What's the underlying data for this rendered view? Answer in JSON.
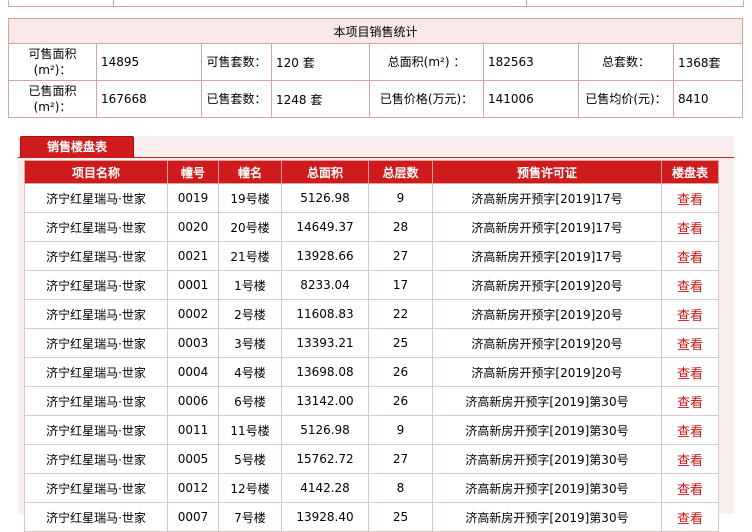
{
  "summary": {
    "title": "本项目销售统计",
    "rows": [
      [
        {
          "label": "可售面积(m²)：",
          "value": "14895"
        },
        {
          "label": "可售套数：",
          "value": "120 套"
        },
        {
          "label": "总面积(m²) ：",
          "value": "182563"
        },
        {
          "label": "总套数：",
          "value": "1368套"
        }
      ],
      [
        {
          "label": "已售面积(m²)：",
          "value": "167668"
        },
        {
          "label": "已售套数：",
          "value": "1248 套"
        },
        {
          "label": "已售价格(万元)：",
          "value": "141006"
        },
        {
          "label": "已售均价(元)：",
          "value": "8410"
        }
      ]
    ]
  },
  "sales_table": {
    "tab_label": "销售楼盘表",
    "headers": [
      "项目名称",
      "幢号",
      "幢名",
      "总面积",
      "总层数",
      "预售许可证",
      "楼盘表"
    ],
    "rows": [
      [
        "济宁红星瑞马·世家",
        "0019",
        "19号楼",
        "5126.98",
        "9",
        "济高新房开预字[2019]17号",
        "查看"
      ],
      [
        "济宁红星瑞马·世家",
        "0020",
        "20号楼",
        "14649.37",
        "28",
        "济高新房开预字[2019]17号",
        "查看"
      ],
      [
        "济宁红星瑞马·世家",
        "0021",
        "21号楼",
        "13928.66",
        "27",
        "济高新房开预字[2019]17号",
        "查看"
      ],
      [
        "济宁红星瑞马·世家",
        "0001",
        "1号楼",
        "8233.04",
        "17",
        "济高新房开预字[2019]20号",
        "查看"
      ],
      [
        "济宁红星瑞马·世家",
        "0002",
        "2号楼",
        "11608.83",
        "22",
        "济高新房开预字[2019]20号",
        "查看"
      ],
      [
        "济宁红星瑞马·世家",
        "0003",
        "3号楼",
        "13393.21",
        "25",
        "济高新房开预字[2019]20号",
        "查看"
      ],
      [
        "济宁红星瑞马·世家",
        "0004",
        "4号楼",
        "13698.08",
        "26",
        "济高新房开预字[2019]20号",
        "查看"
      ],
      [
        "济宁红星瑞马·世家",
        "0006",
        "6号楼",
        "13142.00",
        "26",
        "济高新房开预字[2019]第30号",
        "查看"
      ],
      [
        "济宁红星瑞马·世家",
        "0011",
        "11号楼",
        "5126.98",
        "9",
        "济高新房开预字[2019]第30号",
        "查看"
      ],
      [
        "济宁红星瑞马·世家",
        "0005",
        "5号楼",
        "15762.72",
        "27",
        "济高新房开预字[2019]第30号",
        "查看"
      ],
      [
        "济宁红星瑞马·世家",
        "0012",
        "12号楼",
        "4142.28",
        "8",
        "济高新房开预字[2019]第30号",
        "查看"
      ],
      [
        "济宁红星瑞马·世家",
        "0007",
        "7号楼",
        "13928.40",
        "25",
        "济高新房开预字[2019]第30号",
        "查看"
      ]
    ]
  },
  "colors": {
    "accent": "#cf1b1b",
    "border": "#d9a3a3",
    "link": "#c81414"
  }
}
